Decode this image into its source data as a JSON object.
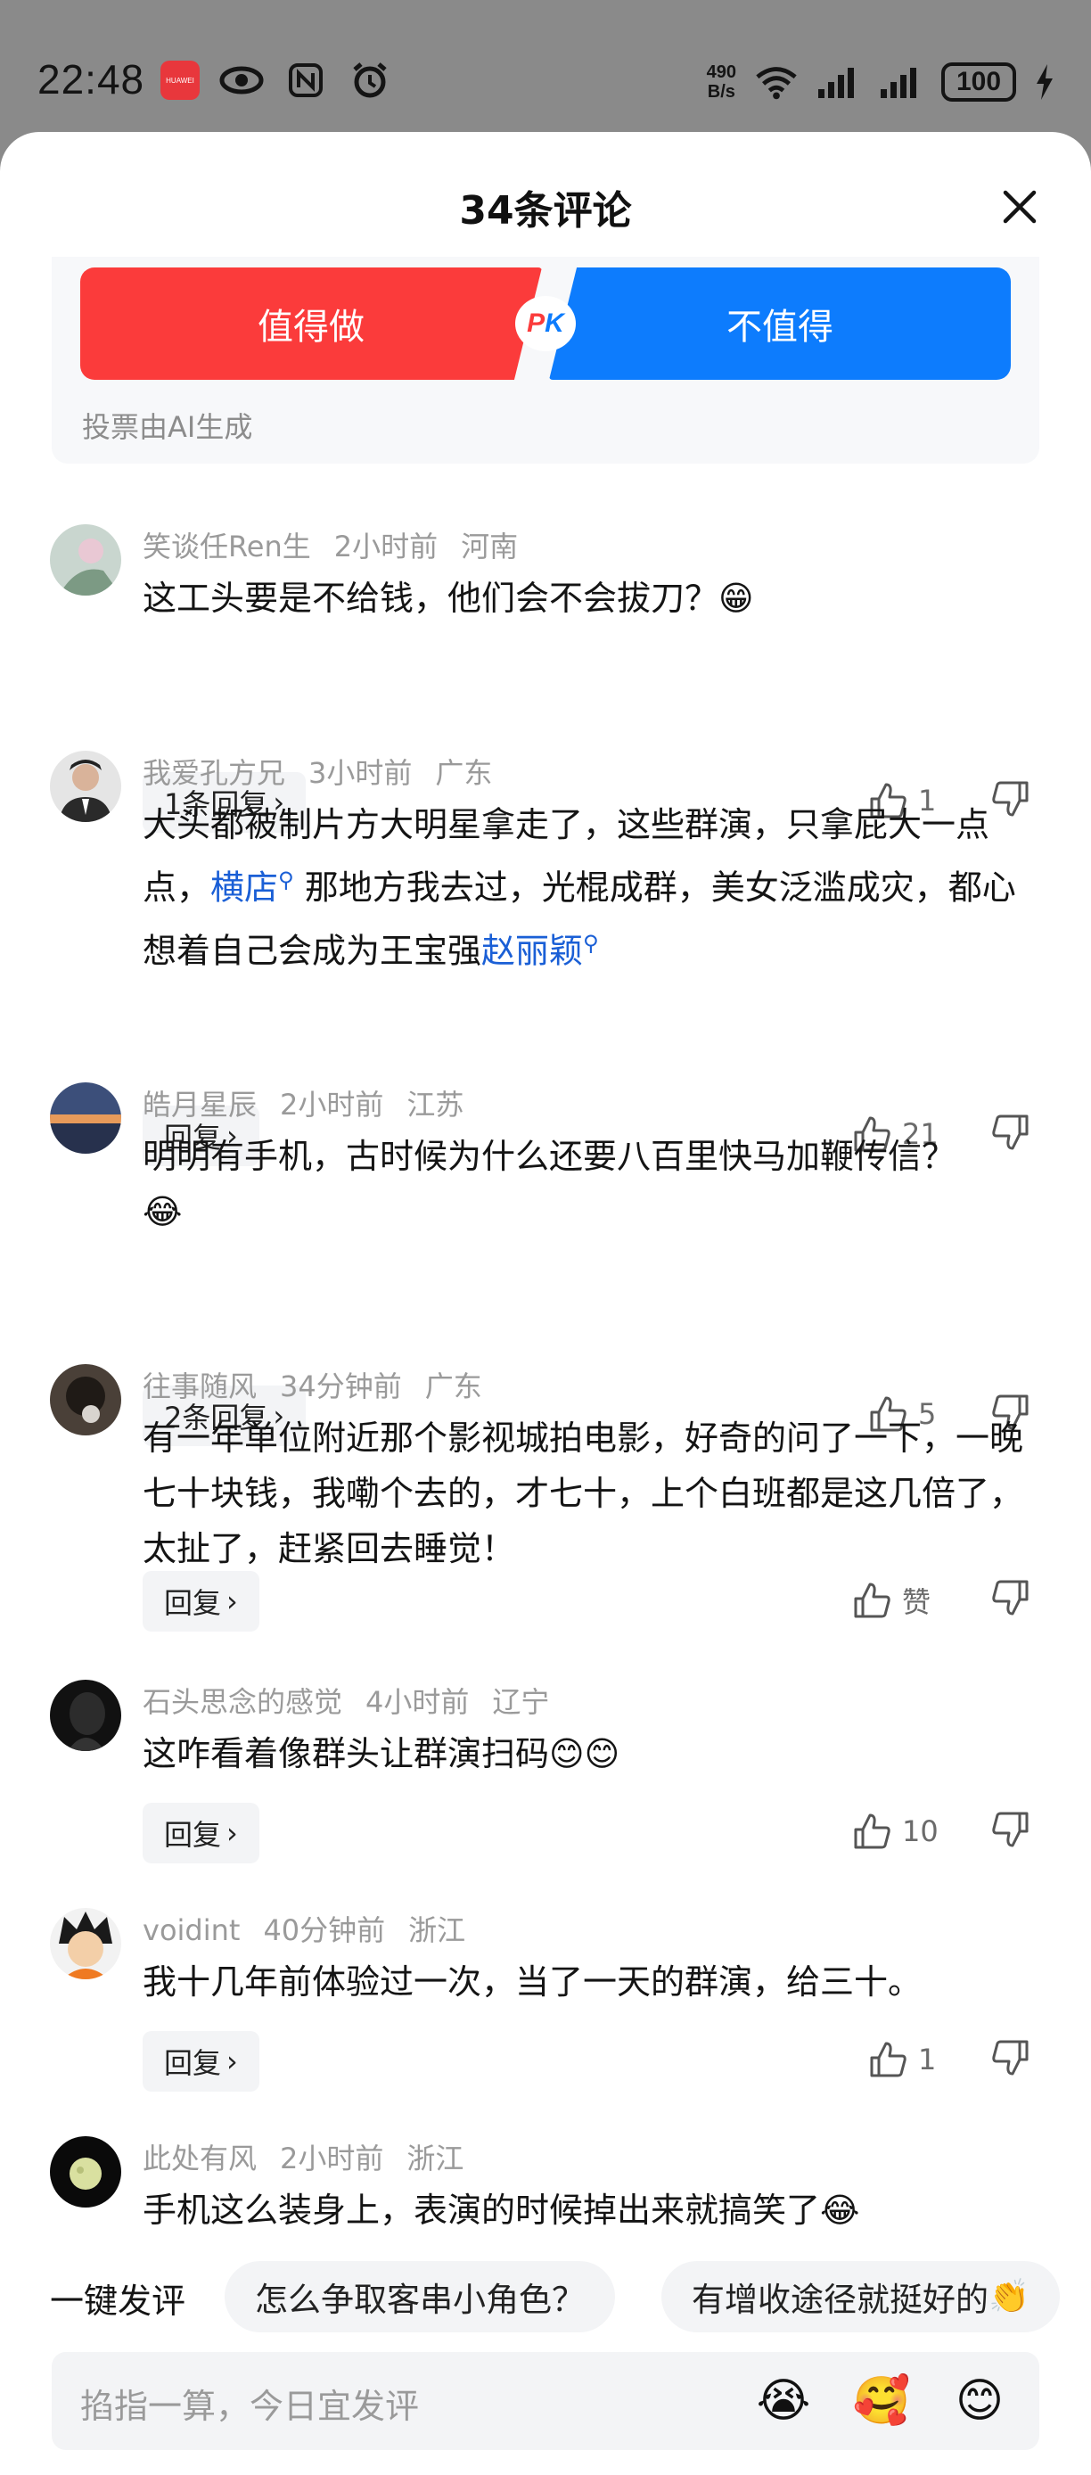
{
  "status_bar": {
    "time": "22:48",
    "brand_badge": "HUAWEI",
    "net_speed_value": "490",
    "net_speed_unit": "B/s",
    "battery": "100"
  },
  "sheet": {
    "title": "34条评论",
    "close_icon": "close-icon"
  },
  "pk": {
    "left_label": "值得做",
    "right_label": "不值得",
    "badge_p": "P",
    "badge_k": "K",
    "note": "投票由AI生成",
    "left_color": "#fb3b3b",
    "right_color": "#0d7cfd"
  },
  "comments": [
    {
      "user": "笑谈任Ren生",
      "time": "2小时前",
      "location": "河南",
      "text": "这工头要是不给钱，他们会不会拔刀？",
      "emoji": "😁",
      "reply": "1条回复",
      "likes": "1"
    },
    {
      "user": "我爱孔方兄",
      "time": "3小时前",
      "location": "广东",
      "text_a": "大头都被制片方大明星拿走了，这些群演，只拿屁大一点点，",
      "link1": "横店",
      "text_b": " 那地方我去过，光棍成群，美女泛滥成灾，都心想着自己会成为王宝强",
      "link2": "赵丽颖",
      "reply": "回复",
      "likes": "21"
    },
    {
      "user": "皓月星辰",
      "time": "2小时前",
      "location": "江苏",
      "text": "明明有手机，古时候为什么还要八百里快马加鞭传信？",
      "emoji": "😂",
      "reply": "2条回复",
      "likes": "5"
    },
    {
      "user": "往事随风",
      "time": "34分钟前",
      "location": "广东",
      "text": "有一年单位附近那个影视城拍电影，好奇的问了一下，一晚七十块钱，我嘞个去的，才七十，上个白班都是这几倍了，太扯了，赶紧回去睡觉！",
      "reply": "回复",
      "likes": "赞"
    },
    {
      "user": "石头思念的感觉",
      "time": "4小时前",
      "location": "辽宁",
      "text": "这咋看着像群头让群演扫码",
      "emoji": "😊😊",
      "reply": "回复",
      "likes": "10"
    },
    {
      "user": "voidint",
      "time": "40分钟前",
      "location": "浙江",
      "text": "我十几年前体验过一次，当了一天的群演，给三十。",
      "reply": "回复",
      "likes": "1"
    },
    {
      "user": "此处有风",
      "time": "2小时前",
      "location": "浙江",
      "text": "手机这么装身上，表演的时候掉出来就搞笑了",
      "emoji": "😂"
    }
  ],
  "quick": {
    "label": "一键发评",
    "chip1": "怎么争取客串小角色？",
    "chip2": "有增收途径就挺好的",
    "chip2_emoji": "👏"
  },
  "input": {
    "placeholder": "掐指一算，今日宜发评",
    "emoji1": "😭",
    "emoji2": "🥰",
    "emoji3": "😊"
  }
}
